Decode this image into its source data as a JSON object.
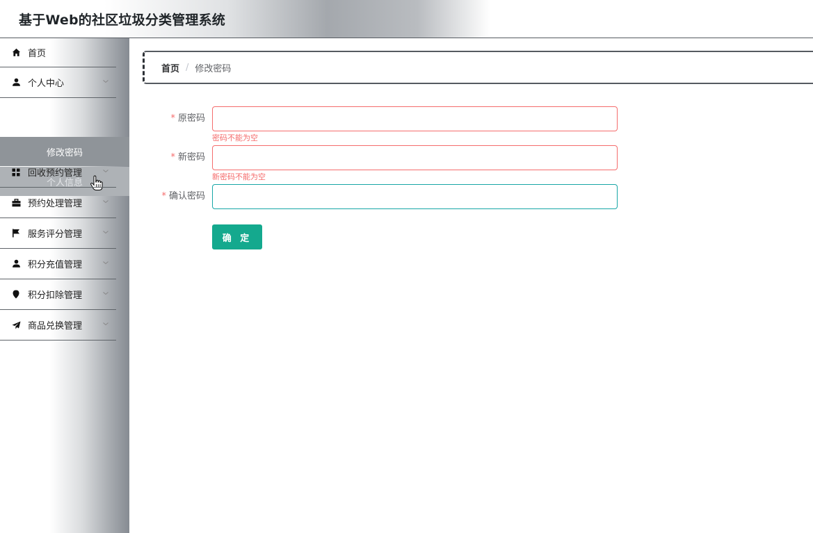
{
  "app": {
    "title": "基于Web的社区垃圾分类管理系统"
  },
  "sidebar": {
    "items": [
      {
        "label": "首页",
        "icon": "home-icon"
      },
      {
        "label": "个人中心",
        "icon": "user-icon",
        "expanded": true,
        "children": [
          {
            "label": "修改密码",
            "active": true
          },
          {
            "label": "个人信息"
          }
        ]
      },
      {
        "label": "回收预约管理",
        "icon": "grid-icon"
      },
      {
        "label": "预约处理管理",
        "icon": "briefcase-icon"
      },
      {
        "label": "服务评分管理",
        "icon": "flag-icon"
      },
      {
        "label": "积分充值管理",
        "icon": "user-icon"
      },
      {
        "label": "积分扣除管理",
        "icon": "map-pin-icon"
      },
      {
        "label": "商品兑换管理",
        "icon": "paper-plane-icon"
      }
    ]
  },
  "breadcrumb": {
    "home": "首页",
    "separator": "/",
    "current": "修改密码"
  },
  "form": {
    "required_mark": "*",
    "fields": [
      {
        "label": "原密码",
        "value": "",
        "error": "密码不能为空"
      },
      {
        "label": "新密码",
        "value": "",
        "error": "新密码不能为空"
      },
      {
        "label": "确认密码",
        "value": "",
        "error": ""
      }
    ],
    "submit_label": "确 定"
  },
  "colors": {
    "accent": "#14a98e",
    "error": "#f56c6c",
    "focus": "#16a6a6"
  }
}
